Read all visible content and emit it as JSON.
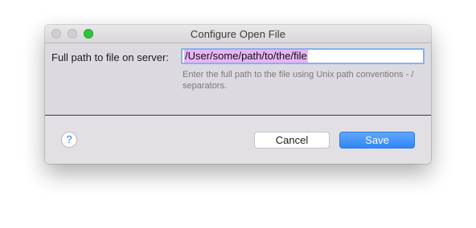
{
  "window": {
    "title": "Configure Open File"
  },
  "form": {
    "label": "Full path to file on server:",
    "path_value": "/User/some/path/to/the/file",
    "help": "Enter the full path to the file using Unix path conventions - / separators."
  },
  "footer": {
    "help_label": "?",
    "cancel_label": "Cancel",
    "save_label": "Save"
  },
  "colors": {
    "zoom_button": "#2fc33f",
    "primary_button": "#3d8ef8",
    "selection_highlight": "#e7b5f6",
    "focus_ring": "#86b3ea"
  }
}
